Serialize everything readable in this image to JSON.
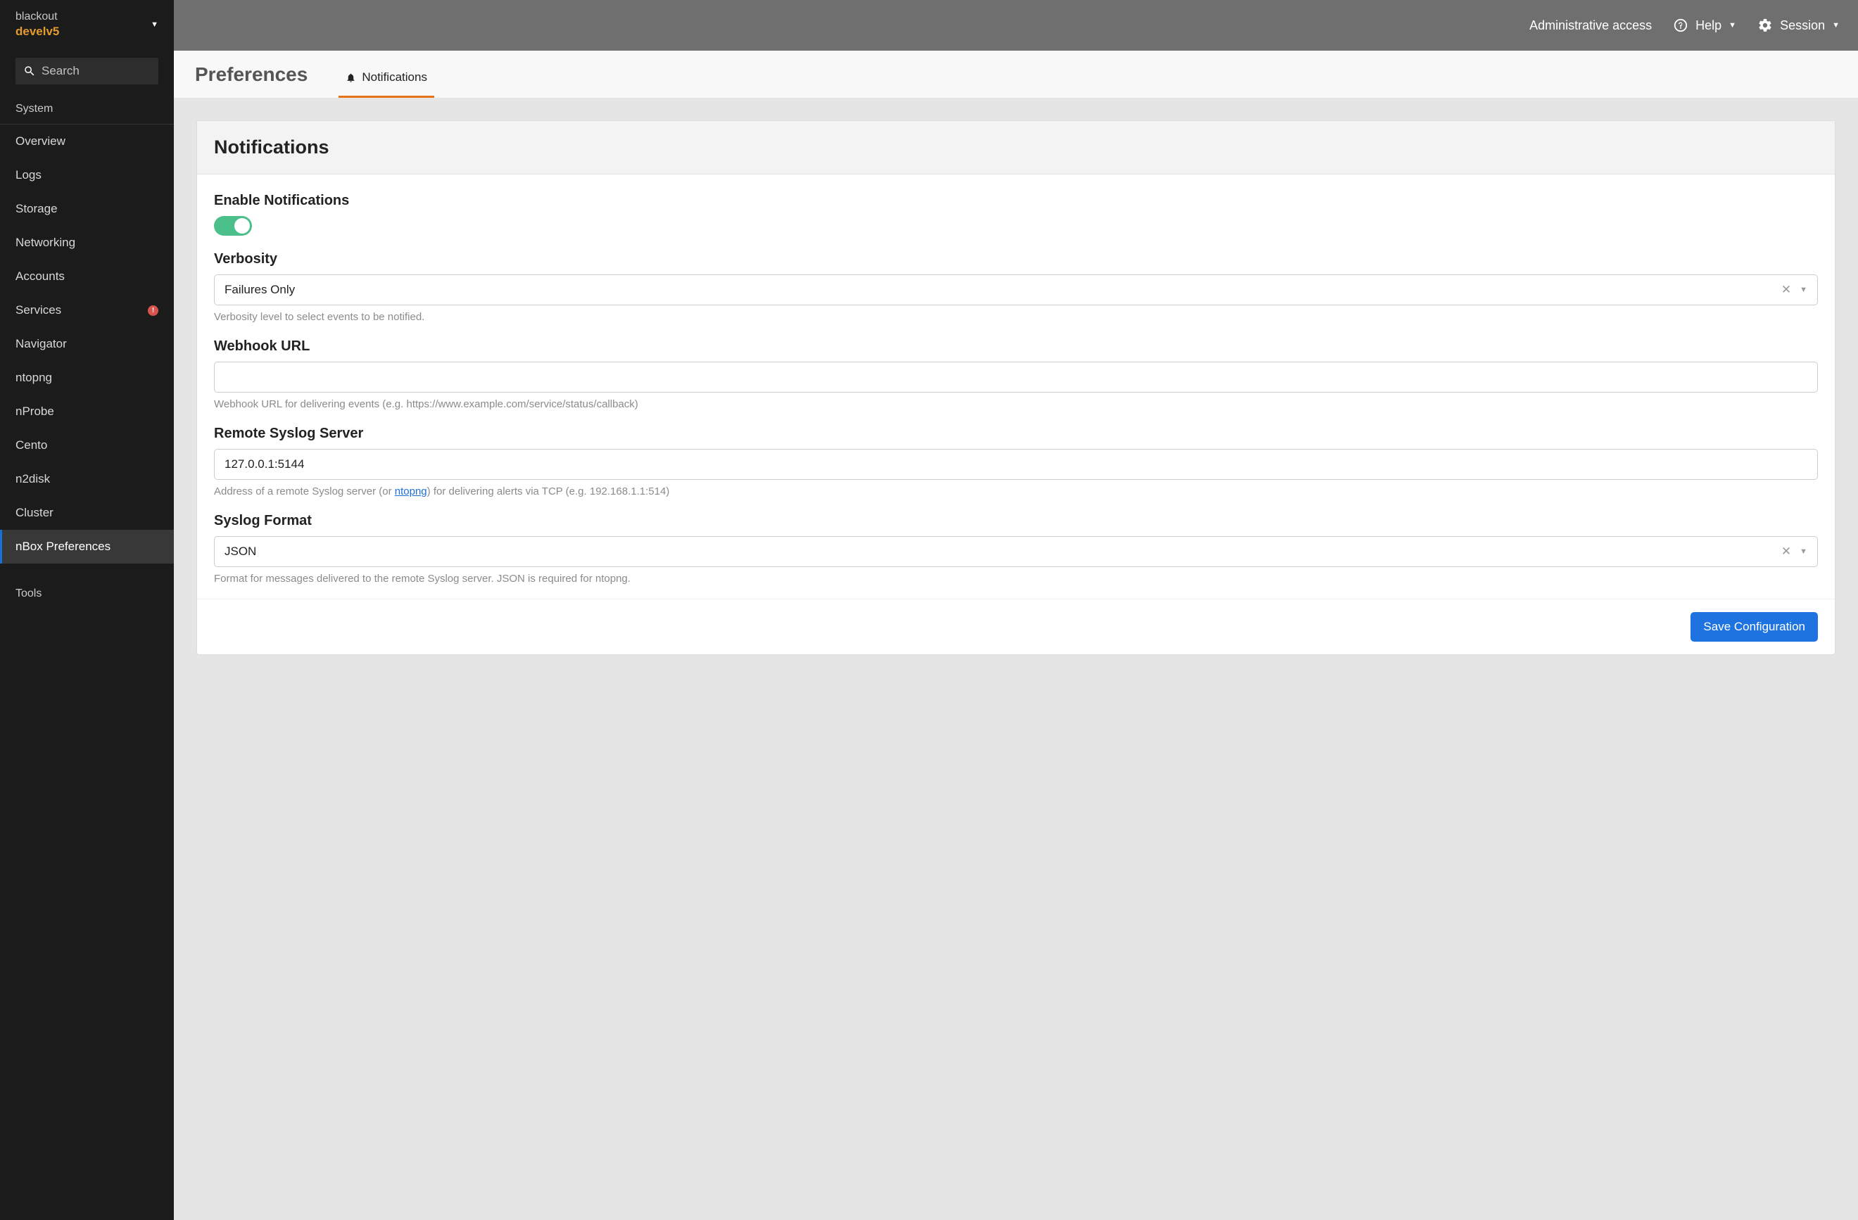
{
  "sidebar": {
    "host": "blackout",
    "env": "develv5",
    "search_placeholder": "Search",
    "section_system": "System",
    "items": [
      {
        "label": "Overview"
      },
      {
        "label": "Logs"
      },
      {
        "label": "Storage"
      },
      {
        "label": "Networking"
      },
      {
        "label": "Accounts"
      },
      {
        "label": "Services",
        "alert": "!"
      },
      {
        "label": "Navigator"
      },
      {
        "label": "ntopng"
      },
      {
        "label": "nProbe"
      },
      {
        "label": "Cento"
      },
      {
        "label": "n2disk"
      },
      {
        "label": "Cluster"
      },
      {
        "label": "nBox Preferences"
      }
    ],
    "section_tools": "Tools"
  },
  "topbar": {
    "admin_access": "Administrative access",
    "help": "Help",
    "session": "Session"
  },
  "page": {
    "title": "Preferences",
    "tab_notifications": "Notifications"
  },
  "card": {
    "title": "Notifications",
    "enable_label": "Enable Notifications",
    "verbosity_label": "Verbosity",
    "verbosity_value": "Failures Only",
    "verbosity_help": "Verbosity level to select events to be notified.",
    "webhook_label": "Webhook URL",
    "webhook_value": "",
    "webhook_help": "Webhook URL for delivering events (e.g. https://www.example.com/service/status/callback)",
    "syslog_label": "Remote Syslog Server",
    "syslog_value": "127.0.0.1:5144",
    "syslog_help_pre": "Address of a remote Syslog server (or ",
    "syslog_help_link": "ntopng",
    "syslog_help_post": ") for delivering alerts via TCP (e.g. 192.168.1.1:514)",
    "syslog_format_label": "Syslog Format",
    "syslog_format_value": "JSON",
    "syslog_format_help": "Format for messages delivered to the remote Syslog server. JSON is required for ntopng.",
    "save_button": "Save Configuration"
  }
}
